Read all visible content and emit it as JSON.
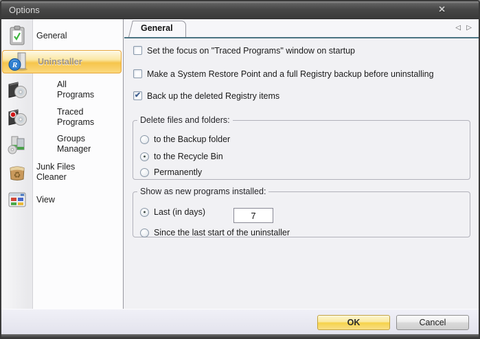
{
  "window": {
    "title": "Options",
    "close_icon": "✕"
  },
  "colors": {
    "selected-item-gold": "#f6c54c",
    "tab-underline-teal": "#4a7382",
    "ok-button-gold": "#f6d24a",
    "check-blue": "#3f5f8f"
  },
  "sidebar": {
    "items": [
      {
        "label": "General",
        "icon": "general-icon",
        "indent": false,
        "selected": false
      },
      {
        "label": "Uninstaller",
        "icon": "uninstaller-icon",
        "indent": false,
        "selected": true
      },
      {
        "label": "All Programs",
        "icon": "all-programs-icon",
        "indent": true,
        "selected": false
      },
      {
        "label": "Traced Programs",
        "icon": "traced-programs-icon",
        "indent": true,
        "selected": false
      },
      {
        "label": "Groups Manager",
        "icon": "groups-manager-icon",
        "indent": true,
        "selected": false
      },
      {
        "label": "Junk Files Cleaner",
        "icon": "junk-files-cleaner-icon",
        "indent": false,
        "selected": false
      },
      {
        "label": "View",
        "icon": "view-icon",
        "indent": false,
        "selected": false
      }
    ]
  },
  "tabs": {
    "active": "General",
    "prev_icon": "◁",
    "next_icon": "▷"
  },
  "general_tab": {
    "checkboxes": [
      {
        "label": "Set the focus on \"Traced Programs\" window on startup",
        "checked": false,
        "mark": ""
      },
      {
        "label": "Make a System Restore Point and a full Registry backup before uninstalling",
        "checked": false,
        "mark": ""
      },
      {
        "label": "Back up the deleted Registry items",
        "checked": true,
        "mark": "✔"
      }
    ],
    "delete_group": {
      "title": "Delete files and folders:",
      "options": [
        {
          "label": "to the Backup folder",
          "selected": false,
          "dot": ""
        },
        {
          "label": "to the Recycle Bin",
          "selected": true,
          "dot": "●"
        },
        {
          "label": "Permanently",
          "selected": false,
          "dot": ""
        }
      ]
    },
    "show_group": {
      "title": "Show as new programs installed:",
      "options": [
        {
          "label": "Last (in days)",
          "selected": true,
          "dot": "●"
        },
        {
          "label": "Since the last start of the uninstaller",
          "selected": false,
          "dot": ""
        }
      ],
      "days_value": "7"
    }
  },
  "footer": {
    "ok": "OK",
    "cancel": "Cancel"
  }
}
